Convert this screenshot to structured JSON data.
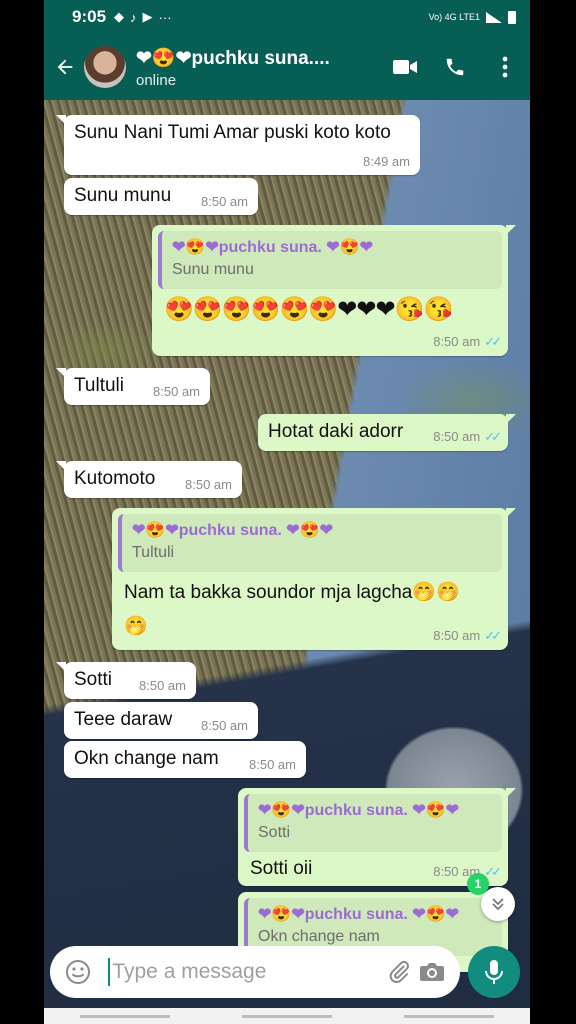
{
  "status_bar": {
    "time": "9:05",
    "network": "Vo) 4G LTE1"
  },
  "header": {
    "title": "❤😍❤puchku suna....",
    "status": "online"
  },
  "messages": [
    {
      "dir": "in",
      "text": "Sunu Nani Tumi Amar puski koto koto",
      "time": "8:49 am"
    },
    {
      "dir": "in",
      "text": "Sunu munu",
      "time": "8:50 am"
    },
    {
      "dir": "out",
      "quote_name": "❤😍❤puchku suna. ❤😍❤",
      "quote_text": "Sunu munu",
      "text": "😍😍😍😍😍😍❤❤❤😘😘",
      "time": "8:50 am"
    },
    {
      "dir": "in",
      "text": "Tultuli",
      "time": "8:50 am"
    },
    {
      "dir": "out",
      "text": "Hotat daki adorr",
      "time": "8:50 am"
    },
    {
      "dir": "in",
      "text": "Kutomoto",
      "time": "8:50 am"
    },
    {
      "dir": "out",
      "quote_name": "❤😍❤puchku suna. ❤😍❤",
      "quote_text": "Tultuli",
      "text_line1": "Nam ta bakka soundor mja lagcha🤭🤭",
      "text_line2": "🤭",
      "time": "8:50 am"
    },
    {
      "dir": "in",
      "text": "Sotti",
      "time": "8:50 am"
    },
    {
      "dir": "in",
      "text": "Teee daraw",
      "time": "8:50 am"
    },
    {
      "dir": "in",
      "text": "Okn change nam",
      "time": "8:50 am"
    },
    {
      "dir": "out",
      "quote_name": "❤😍❤puchku suna. ❤😍❤",
      "quote_text": "Sotti",
      "text": "Sotti oii",
      "time": "8:50 am"
    },
    {
      "dir": "out",
      "quote_name": "❤😍❤puchku suna. ❤😍❤",
      "quote_text": "Okn change nam"
    }
  ],
  "unread_count": "1",
  "input": {
    "placeholder": "Type a message"
  },
  "colors": {
    "header": "#075e54",
    "outgoing": "#dcf8c6",
    "incoming": "#ffffff",
    "accent": "#128c7e",
    "read_tick": "#4fc3f7"
  },
  "icons": [
    "back-arrow-icon",
    "video-call-icon",
    "phone-icon",
    "more-vert-icon",
    "emoji-icon",
    "attach-icon",
    "camera-icon",
    "mic-icon",
    "chevron-down-icon"
  ]
}
